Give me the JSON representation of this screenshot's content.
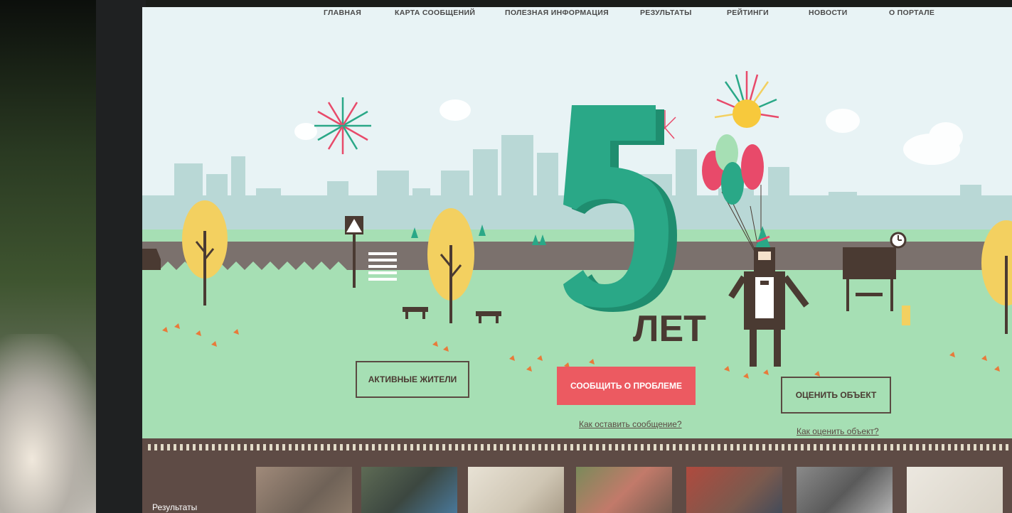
{
  "nav": {
    "items": [
      "ГЛАВНАЯ",
      "КАРТА СООБЩЕНИЙ",
      "ПОЛЕЗНАЯ ИНФОРМАЦИЯ",
      "РЕЗУЛЬТАТЫ",
      "РЕЙТИНГИ",
      "НОВОСТИ",
      "О ПОРТАЛЕ"
    ]
  },
  "hero": {
    "number": "5",
    "suffix": "ЛЕТ"
  },
  "actions": {
    "active_residents": "АКТИВНЫЕ ЖИТЕЛИ",
    "report_problem": "СООБЩИТЬ О ПРОБЛЕМЕ",
    "report_help_link": "Как оставить сообщение?",
    "rate_object": "ОЦЕНИТЬ ОБЪЕКТ",
    "rate_help_link": "Как оценить объект?"
  },
  "results": {
    "label": "Результаты",
    "thumbnails": [
      "photo-1",
      "photo-2",
      "photo-3",
      "photo-4",
      "photo-5",
      "photo-6",
      "photo-7"
    ]
  },
  "colors": {
    "sky": "#e8f3f5",
    "grass": "#a6dfb4",
    "road": "#7b716d",
    "teal": "#2aa887",
    "red_button": "#ec5a61",
    "film_strip": "#5e4b45",
    "tree_yellow": "#f3d060"
  }
}
